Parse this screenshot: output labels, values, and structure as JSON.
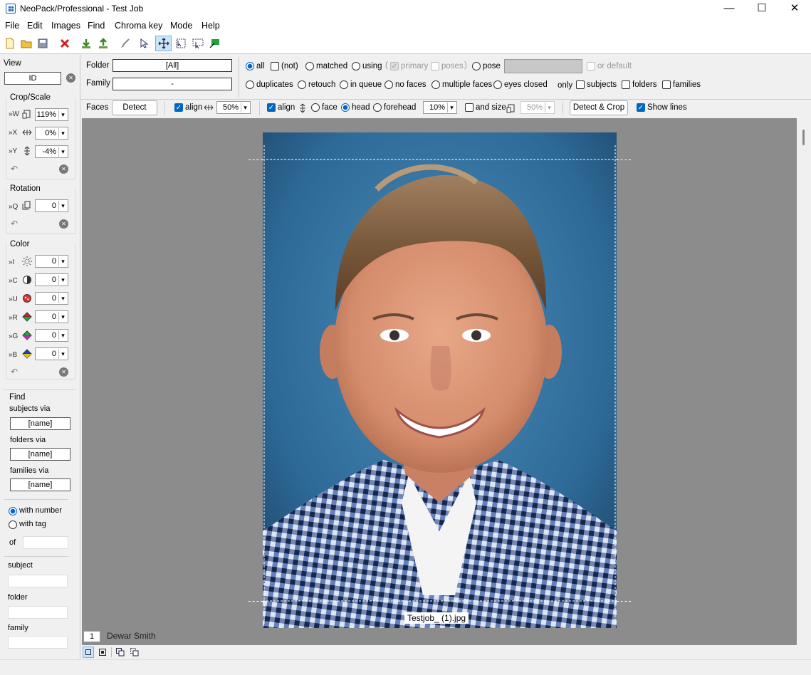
{
  "window": {
    "title": "NeoPack/Professional - Test Job",
    "minimize": "—",
    "maximize": "☐",
    "close": "✕"
  },
  "menu": [
    "File",
    "Edit",
    "Images",
    "Find",
    "Chroma key",
    "Mode",
    "Help"
  ],
  "sidebar": {
    "view_label": "View",
    "view_value": "ID",
    "cropscale_title": "Crop/Scale",
    "crop": [
      {
        "label": "»W",
        "value": "119%"
      },
      {
        "label": "»X",
        "value": "0%"
      },
      {
        "label": "»Y",
        "value": "-4%"
      }
    ],
    "rotation_title": "Rotation",
    "rotation": {
      "label": "»Q",
      "value": "0"
    },
    "color_title": "Color",
    "color": [
      {
        "label": "»I",
        "value": "0"
      },
      {
        "label": "»C",
        "value": "0"
      },
      {
        "label": "»U",
        "value": "0"
      },
      {
        "label": "»R",
        "value": "0"
      },
      {
        "label": "»G",
        "value": "0"
      },
      {
        "label": "»B",
        "value": "0"
      }
    ],
    "find_title": "Find",
    "subjects_via": "subjects via",
    "subjects_value": "[name]",
    "folders_via": "folders via",
    "folders_value": "[name]",
    "families_via": "families via",
    "families_value": "[name]",
    "with_number": "with number",
    "with_tag": "with tag",
    "of": "of",
    "subject": "subject",
    "folder": "folder",
    "family": "family"
  },
  "filter": {
    "folder_label": "Folder",
    "folder_value": "[All]",
    "family_label": "Family",
    "family_value": "-",
    "all": "all",
    "not": "(not)",
    "matched": "matched",
    "using": "using",
    "paren_open": "(",
    "primary": "primary",
    "poses": "poses",
    "paren_close": ")",
    "pose": "pose",
    "or_default": "or default",
    "duplicates": "duplicates",
    "retouch": "retouch",
    "in_queue": "in queue",
    "no_faces": "no faces",
    "multiple_faces": "multiple faces",
    "eyes_closed": "eyes closed",
    "only": "only",
    "subjects": "subjects",
    "folders": "folders",
    "families": "families"
  },
  "faces": {
    "label": "Faces",
    "detect": "Detect",
    "align1": "align",
    "pct1": "50%",
    "align2": "align",
    "face": "face",
    "head": "head",
    "forehead": "forehead",
    "pct2": "10%",
    "and_size": "and size",
    "pct3": "50%",
    "detect_crop": "Detect & Crop",
    "show_lines": "Show lines"
  },
  "image": {
    "filename": "Testjob_ (1).jpg",
    "index": "1",
    "subject_name": "Dewar Smith"
  }
}
